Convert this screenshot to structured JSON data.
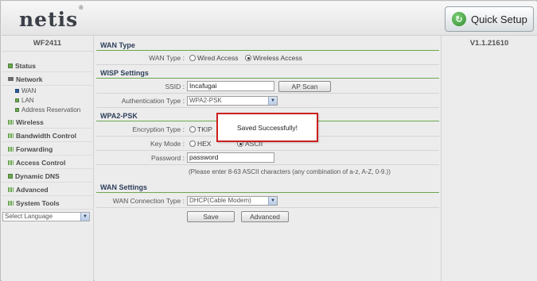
{
  "header": {
    "logo": "netis",
    "logo_mark": "®",
    "quick_setup": "Quick Setup"
  },
  "sidebar": {
    "model": "WF2411",
    "items": [
      {
        "label": "Status"
      },
      {
        "label": "Network",
        "expanded": true
      },
      {
        "label": "Wireless"
      },
      {
        "label": "Bandwidth Control"
      },
      {
        "label": "Forwarding"
      },
      {
        "label": "Access Control"
      },
      {
        "label": "Dynamic DNS"
      },
      {
        "label": "Advanced"
      },
      {
        "label": "System Tools"
      }
    ],
    "network_sub": [
      {
        "label": "WAN",
        "active": true
      },
      {
        "label": "LAN"
      },
      {
        "label": "Address Reservation"
      }
    ],
    "language": "Select Language"
  },
  "version": "V1.1.21610",
  "wan_type": {
    "section": "WAN Type",
    "label": "WAN Type :",
    "options": [
      "Wired Access",
      "Wireless Access"
    ],
    "selected": "Wireless Access"
  },
  "wisp": {
    "section": "WISP Settings",
    "ssid_label": "SSID :",
    "ssid_value": "Incafugai",
    "ap_scan": "AP Scan",
    "auth_label": "Authentication Type :",
    "auth_value": "WPA2-PSK"
  },
  "wpa2": {
    "section": "WPA2-PSK",
    "enc_label": "Encryption Type :",
    "enc_option": "TKIP",
    "key_label": "Key Mode :",
    "key_options": [
      "HEX",
      "ASCII"
    ],
    "key_selected": "ASCII",
    "pw_label": "Password :",
    "pw_value": "password",
    "note": "(Please enter 8-63 ASCII characters (any combination of a-z, A-Z, 0-9.))"
  },
  "wan_settings": {
    "section": "WAN Settings",
    "conn_label": "WAN Connection Type :",
    "conn_value": "DHCP(Cable Modem)"
  },
  "buttons": {
    "save": "Save",
    "advanced": "Advanced"
  },
  "popup": {
    "message": "Saved Successfully!"
  },
  "colors": {
    "accent_green": "#6aa84f",
    "popup_border": "#cc1f1f",
    "section_text": "#2d3e5a"
  }
}
